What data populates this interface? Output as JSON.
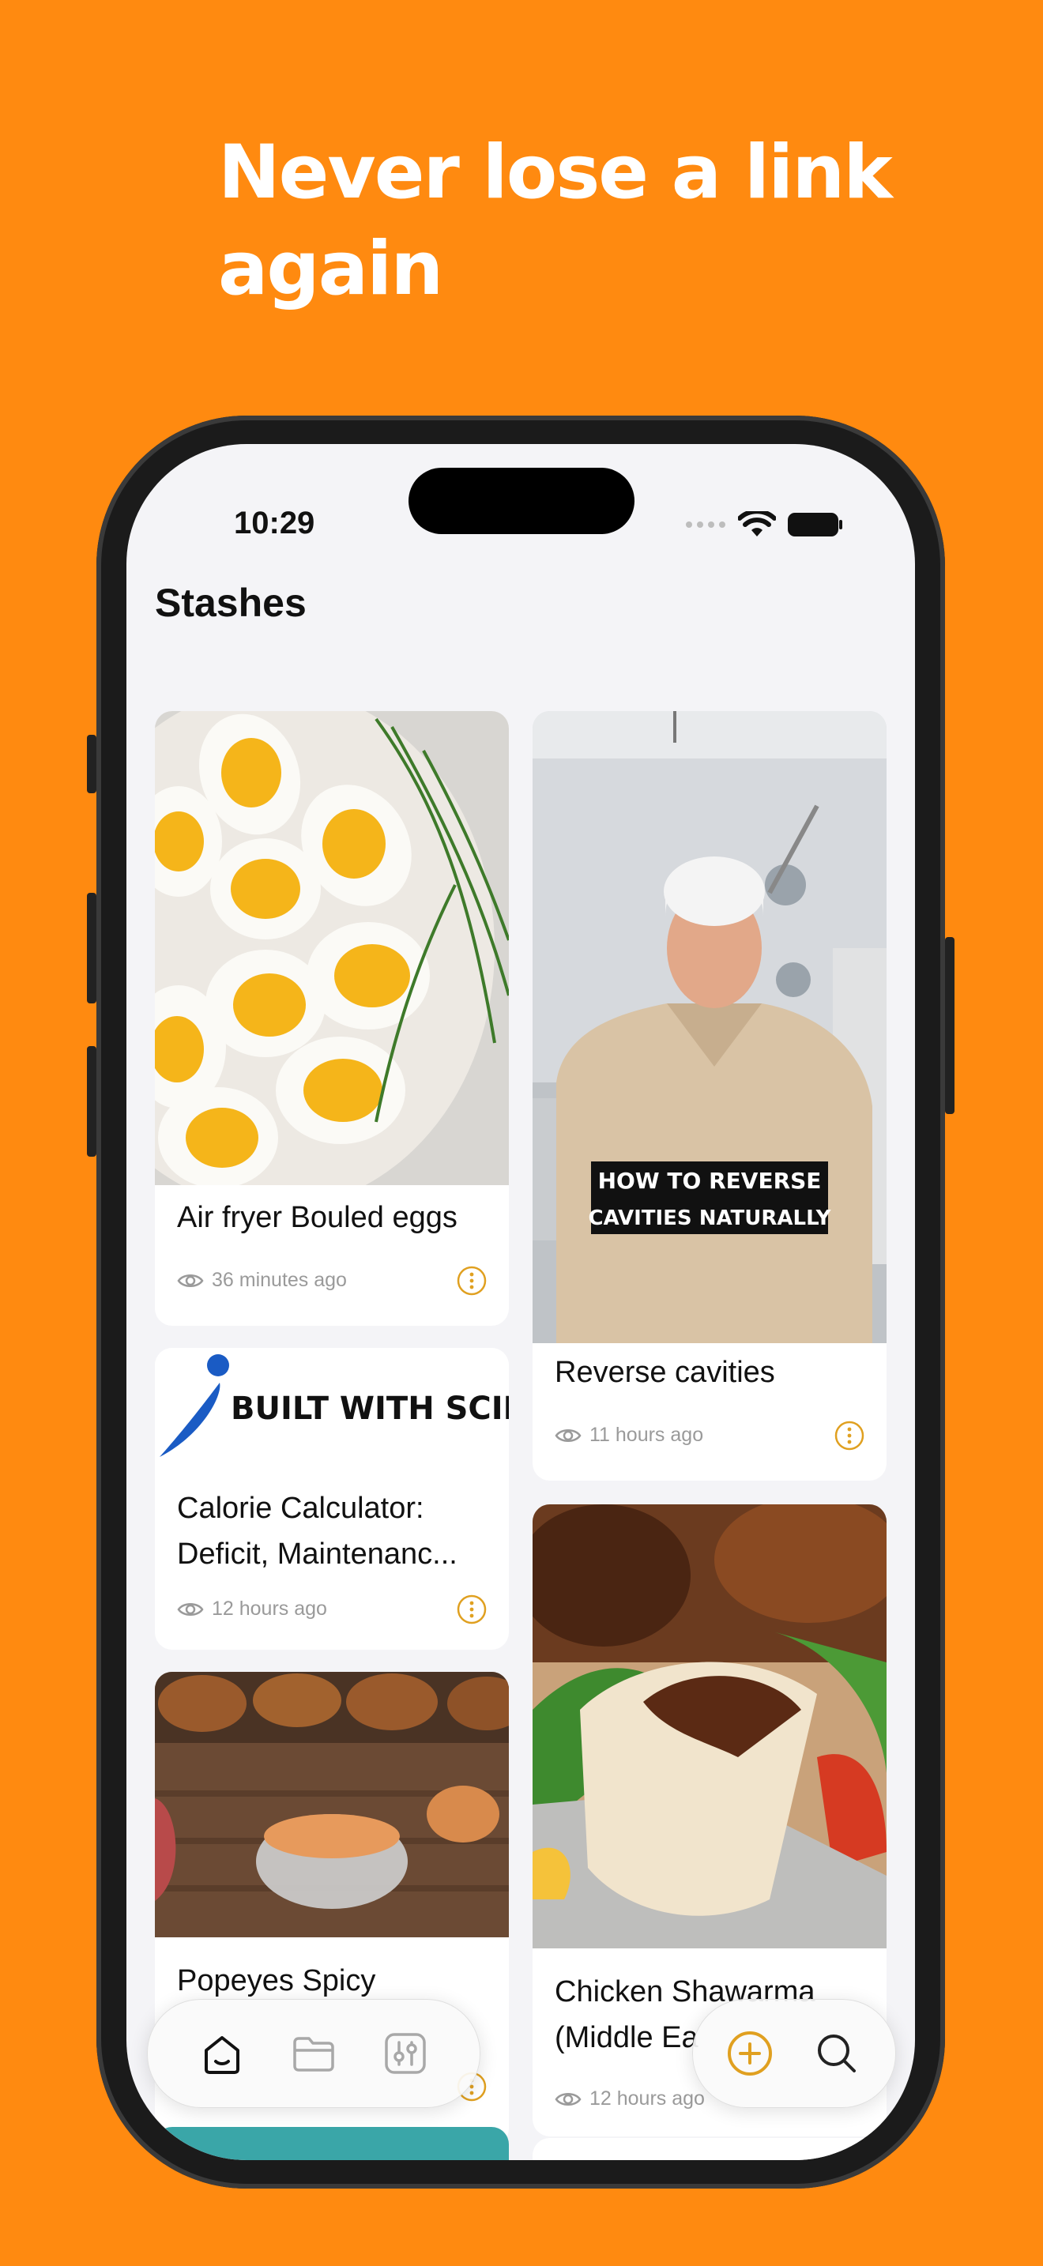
{
  "headline": "Never lose a link again",
  "status": {
    "time": "10:29"
  },
  "screen": {
    "title": "Stashes"
  },
  "cards": [
    {
      "title": "Air fryer Bouled eggs",
      "time": "36 minutes ago"
    },
    {
      "title": "Reverse cavities",
      "time": "11 hours ago",
      "overlay_line1": "HOW TO REVERSE",
      "overlay_line2": "CAVITIES NATURALLY"
    },
    {
      "title": "Calorie Calculator: Deficit, Maintenanc...",
      "time": "12 hours ago",
      "logo_text": "BUILT WITH SCIENCE"
    },
    {
      "title": "Chicken Shawarma (Middle Ea",
      "time": "12 hours ago"
    },
    {
      "title": "Popeyes Spicy"
    }
  ],
  "icons": {
    "views": "eye-icon",
    "more": "more-options-icon",
    "home": "home-icon",
    "folder": "folder-icon",
    "settings": "sliders-icon",
    "add": "plus-circle-icon",
    "search": "search-icon"
  },
  "colors": {
    "background": "#FF8A10",
    "accent": "#E0A020",
    "screen": "#F4F4F7"
  }
}
